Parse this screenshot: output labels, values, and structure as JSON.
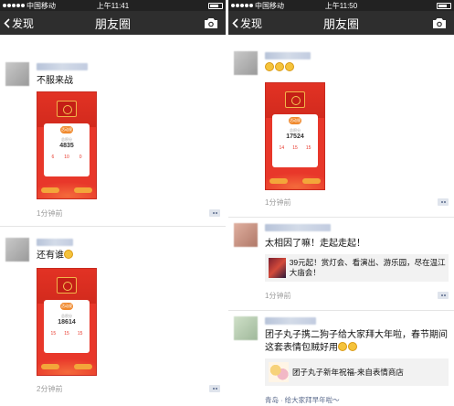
{
  "left": {
    "status": {
      "carrier": "中国移动",
      "time": "上午11:41"
    },
    "nav": {
      "back": "发现",
      "title": "朋友圈"
    },
    "posts": [
      {
        "text": "不服来战",
        "packet": {
          "tag": "活动规则",
          "label": "总积分",
          "score": "4835",
          "stats": [
            "6",
            "10",
            "0"
          ]
        },
        "time": "1分钟前"
      },
      {
        "text": "还有谁",
        "packet": {
          "tag": "活动规则",
          "label": "总积分",
          "score": "18614",
          "stats": [
            "15",
            "15",
            "15"
          ]
        },
        "time": "2分钟前"
      }
    ]
  },
  "right": {
    "status": {
      "carrier": "中国移动",
      "time": "上午11:50"
    },
    "nav": {
      "back": "发现",
      "title": "朋友圈"
    },
    "posts": [
      {
        "text": "",
        "packet": {
          "tag": "活动规则",
          "label": "总积分",
          "score": "17524",
          "stats": [
            "14",
            "15",
            "15"
          ]
        },
        "time": "1分钟前"
      },
      {
        "text": "太相因了嘛！走起走起！",
        "link": "39元起！赏灯会、看演出、游乐园，尽在温江大庙会！",
        "time": "1分钟前"
      },
      {
        "text": "团子丸子携二狗子给大家拜大年啦，春节期间这套表情包贼好用",
        "link": "团子丸子新年祝福-来自表情商店",
        "location": "青岛 · 给大家拜早年啦～"
      }
    ]
  },
  "colors": {
    "navbar": "#2e2e2e",
    "packet": "#e8372a",
    "link": "#5b6b8c",
    "meta": "#9b9b9b"
  }
}
